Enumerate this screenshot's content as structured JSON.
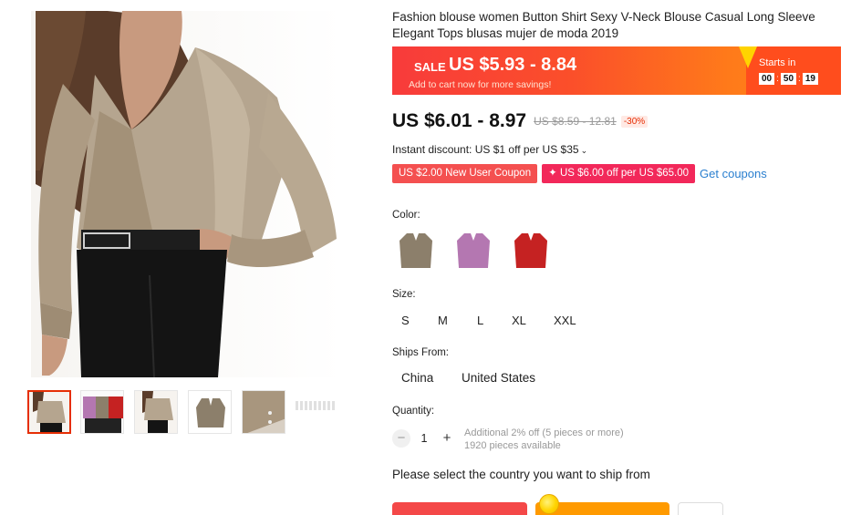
{
  "product": {
    "title": "Fashion blouse women Button Shirt Sexy V-Neck Blouse Casual Long Sleeve Elegant Tops blusas mujer de moda 2019"
  },
  "sale": {
    "label": "SALE",
    "price": "US $5.93 - 8.84",
    "subtext": "Add to cart now for more savings!",
    "starts_label": "Starts in",
    "countdown": {
      "hours": "00",
      "minutes": "50",
      "seconds": "19",
      "separator": ":"
    }
  },
  "pricing": {
    "current": "US $6.01 - 8.97",
    "original": "US $8.59 - 12.81",
    "discount": "-30%"
  },
  "instant_discount": "Instant discount: US $1 off per US $35",
  "coupons": {
    "items": [
      "US $2.00 New User Coupon",
      "✦ US $6.00 off per US $65.00"
    ],
    "get_label": "Get coupons"
  },
  "color": {
    "label": "Color:",
    "options": [
      "khaki-swatch",
      "purple-swatch",
      "red-swatch"
    ],
    "values": [
      "#8c7f6b",
      "#b477b1",
      "#c52222"
    ]
  },
  "size": {
    "label": "Size:",
    "options": [
      "S",
      "M",
      "L",
      "XL",
      "XXL"
    ]
  },
  "ships_from": {
    "label": "Ships From:",
    "options": [
      "China",
      "United States"
    ]
  },
  "quantity": {
    "label": "Quantity:",
    "minus": "−",
    "value": "1",
    "plus": "+",
    "additional": "Additional 2% off (5 pieces or more)",
    "available": "1920 pieces available"
  },
  "ship_message": "Please select the country you want to ship from",
  "colors": {
    "sale_red": "#f83b3b",
    "sale_orange": "#ff8a15",
    "accent": "#e62e04",
    "link": "#2a7fcf"
  }
}
